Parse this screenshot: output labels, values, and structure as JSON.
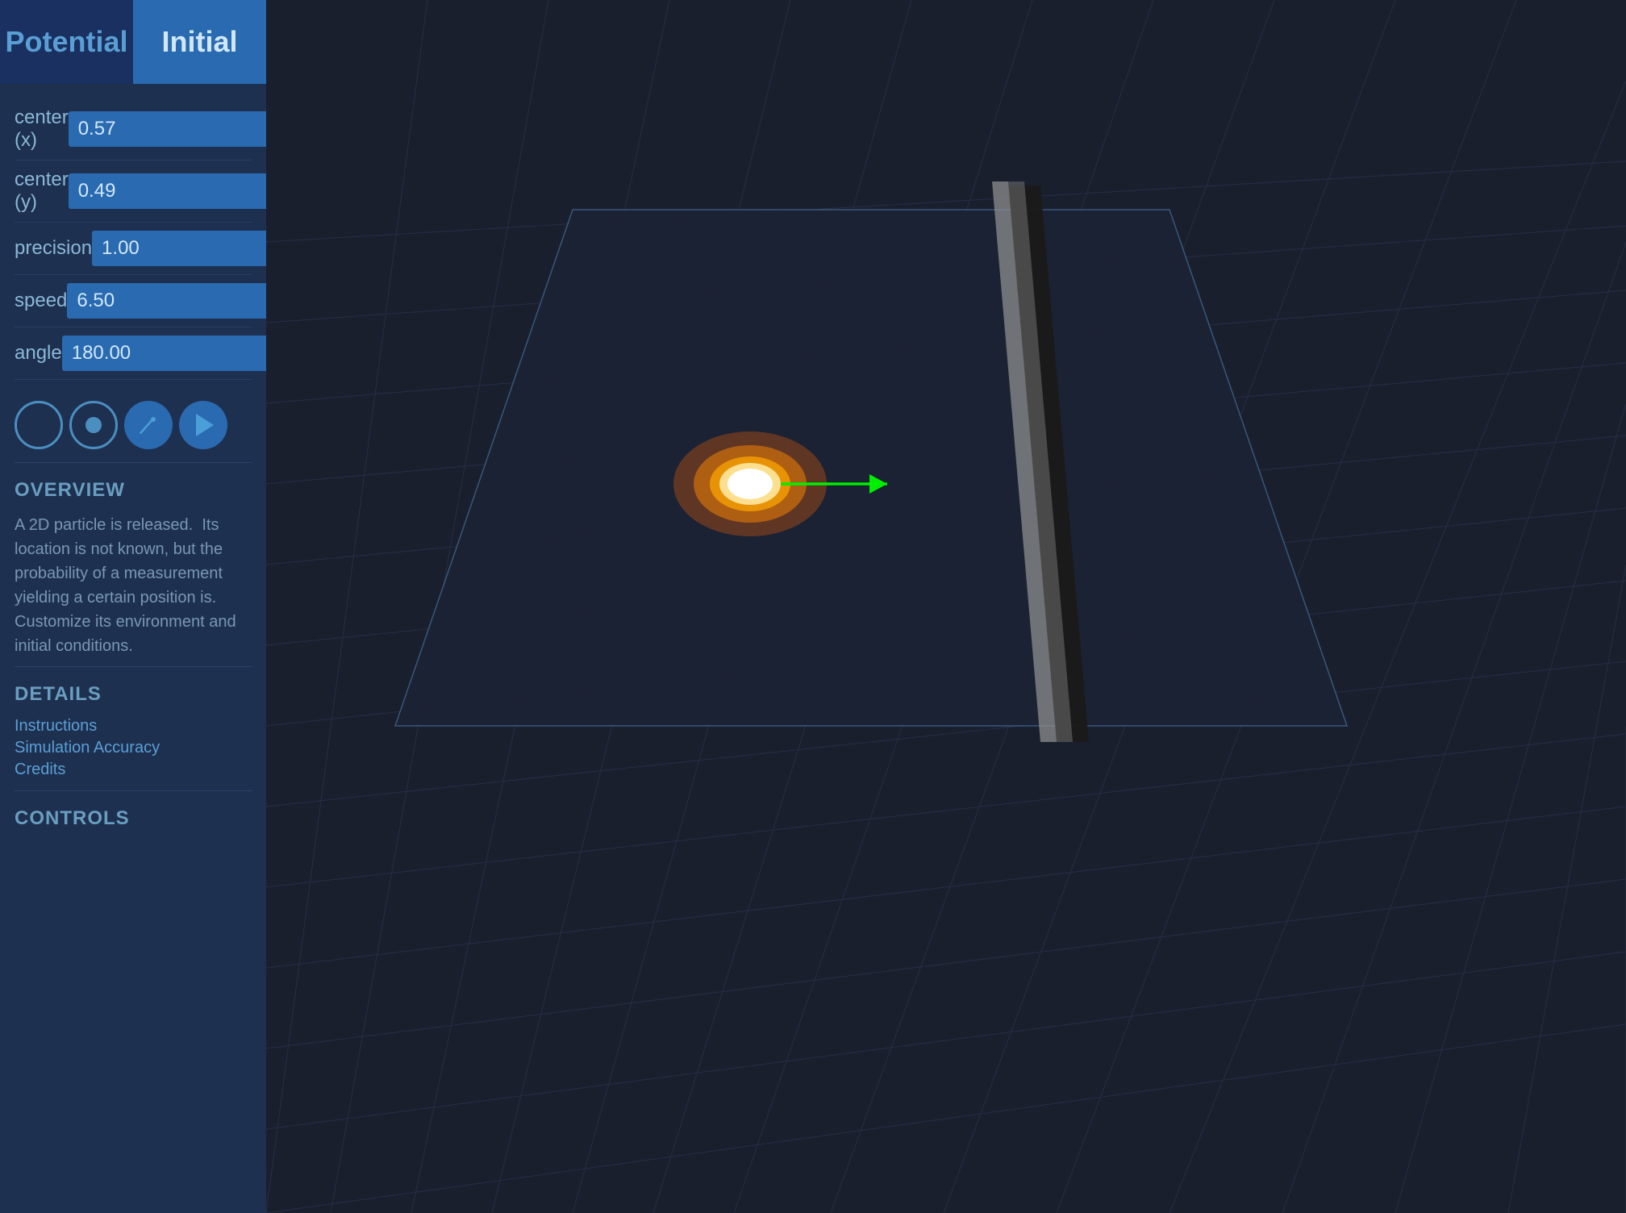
{
  "tabs": [
    {
      "id": "potential",
      "label": "Potential"
    },
    {
      "id": "initial",
      "label": "Initial",
      "active": true
    }
  ],
  "params": [
    {
      "label": "center (x)",
      "value": "0.57"
    },
    {
      "label": "center (y)",
      "value": "0.49"
    },
    {
      "label": "precision",
      "value": "1.00"
    },
    {
      "label": "speed",
      "value": "6.50"
    },
    {
      "label": "angle",
      "value": "180.00"
    }
  ],
  "controls": [
    {
      "name": "circle-outline-btn",
      "type": "circle-outer"
    },
    {
      "name": "circle-dot-btn",
      "type": "circle-inner"
    },
    {
      "name": "pencil-btn",
      "type": "pencil"
    },
    {
      "name": "play-btn",
      "type": "play"
    }
  ],
  "overview": {
    "title": "OVERVIEW",
    "text": "A 2D particle is released.  Its location is not known, but the probability of a measurement yielding a certain position is.\nCustomize its environment and initial conditions."
  },
  "details": {
    "title": "DETAILS",
    "links": [
      "Instructions",
      "Simulation Accuracy",
      "Credits"
    ]
  },
  "controls_section": {
    "title": "CONTROLS"
  }
}
